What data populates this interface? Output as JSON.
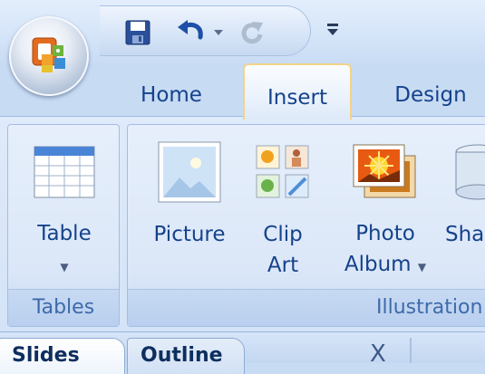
{
  "quick_access": {
    "buttons": [
      "save-icon",
      "undo-icon",
      "dropdown-arrow-icon",
      "redo-icon",
      "customize-icon"
    ]
  },
  "tabs": [
    {
      "label": "Home",
      "selected": false
    },
    {
      "label": "Insert",
      "selected": true
    },
    {
      "label": "Design",
      "selected": false
    }
  ],
  "ribbon": {
    "groups": [
      {
        "label": "Tables",
        "buttons": [
          {
            "label": "Table",
            "icon": "table-icon",
            "dropdown": true
          }
        ]
      },
      {
        "label": "Illustration",
        "buttons": [
          {
            "label": "Picture",
            "icon": "picture-icon",
            "dropdown": false
          },
          {
            "label_line1": "Clip",
            "label_line2": "Art",
            "icon": "clip-art-icon",
            "dropdown": false
          },
          {
            "label_line1": "Photo",
            "label_line2": "Album",
            "icon": "photo-album-icon",
            "dropdown": true
          },
          {
            "label": "Sha",
            "icon": "shapes-icon"
          }
        ]
      }
    ]
  },
  "pane_tabs": [
    {
      "label": "Slides",
      "selected": true
    },
    {
      "label": "Outline",
      "selected": false
    }
  ],
  "pane_close_label": "X",
  "colors": {
    "tab_text": "#15428b",
    "group_label": "#3e6aaa",
    "ribbon_background": "#d4e3f7",
    "selected_tab_border": "#f3d389"
  }
}
